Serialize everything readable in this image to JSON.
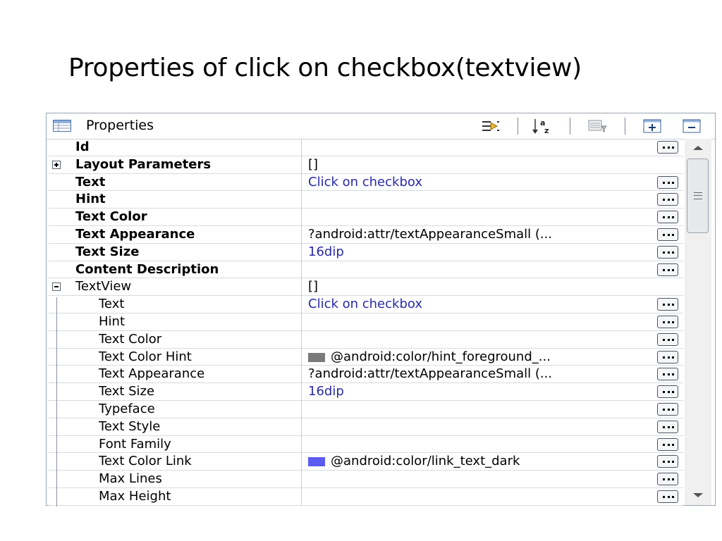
{
  "slide": {
    "title": "Properties of click on checkbox(textview)"
  },
  "panel": {
    "title": "Properties"
  },
  "toolbar": {
    "icons": [
      "show-advanced-icon",
      "sort-alpha-icon",
      "filter-icon",
      "expand-all-icon",
      "collapse-all-icon"
    ]
  },
  "colors": {
    "hint_swatch": "#7a7a7a",
    "link_swatch": "#5b5bf0",
    "value_blue": "#2a2aa8"
  },
  "rows": [
    {
      "name": "Id",
      "value": "",
      "bold": true
    },
    {
      "name": "Layout Parameters",
      "value": "[]",
      "bold": true,
      "expander": "plus"
    },
    {
      "name": "Text",
      "value": "Click on checkbox",
      "bold": true,
      "blue": true
    },
    {
      "name": "Hint",
      "value": "",
      "bold": true
    },
    {
      "name": "Text Color",
      "value": "",
      "bold": true
    },
    {
      "name": "Text Appearance",
      "value": "?android:attr/textAppearanceSmall (...",
      "bold": true
    },
    {
      "name": "Text Size",
      "value": "16dip",
      "bold": true,
      "blue": true
    },
    {
      "name": "Content Description",
      "value": "",
      "bold": true
    },
    {
      "name": "TextView",
      "value": "[]",
      "expander": "minus"
    },
    {
      "name": "Text",
      "value": "Click on checkbox",
      "child": true,
      "blue": true
    },
    {
      "name": "Hint",
      "value": "",
      "child": true
    },
    {
      "name": "Text Color",
      "value": "",
      "child": true
    },
    {
      "name": "Text Color Hint",
      "value": "@android:color/hint_foreground_...",
      "child": true,
      "swatch": "#7a7a7a"
    },
    {
      "name": "Text Appearance",
      "value": "?android:attr/textAppearanceSmall (...",
      "child": true
    },
    {
      "name": "Text Size",
      "value": "16dip",
      "child": true,
      "blue": true
    },
    {
      "name": "Typeface",
      "value": "",
      "child": true
    },
    {
      "name": "Text Style",
      "value": "",
      "child": true
    },
    {
      "name": "Font Family",
      "value": "",
      "child": true
    },
    {
      "name": "Text Color Link",
      "value": "@android:color/link_text_dark",
      "child": true,
      "swatch": "#5b5bf0"
    },
    {
      "name": "Max Lines",
      "value": "",
      "child": true
    },
    {
      "name": "Max Height",
      "value": "",
      "child": true
    }
  ]
}
